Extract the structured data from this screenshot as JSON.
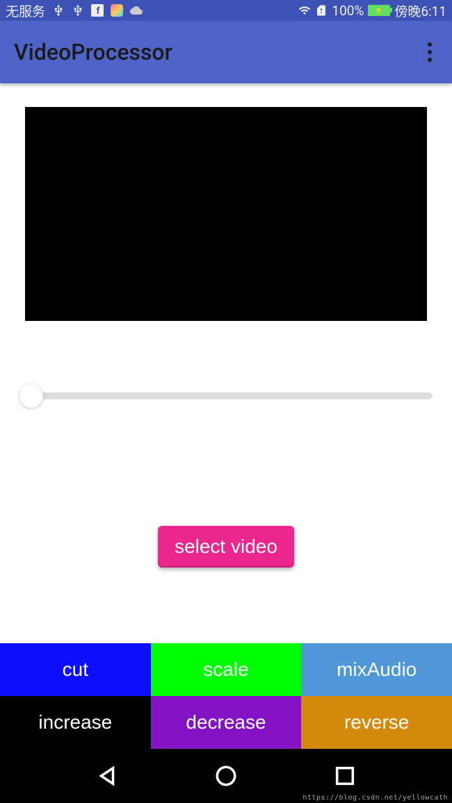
{
  "status_bar": {
    "service_text": "无服务",
    "battery_percent": "100%",
    "time": "傍晚6:11"
  },
  "app_bar": {
    "title": "VideoProcessor"
  },
  "controls": {
    "select_video_label": "select video"
  },
  "buttons": {
    "cut": "cut",
    "scale": "scale",
    "mixAudio": "mixAudio",
    "increase": "increase",
    "decrease": "decrease",
    "reverse": "reverse"
  },
  "watermark": "https://blog.csdn.net/yellowcath"
}
